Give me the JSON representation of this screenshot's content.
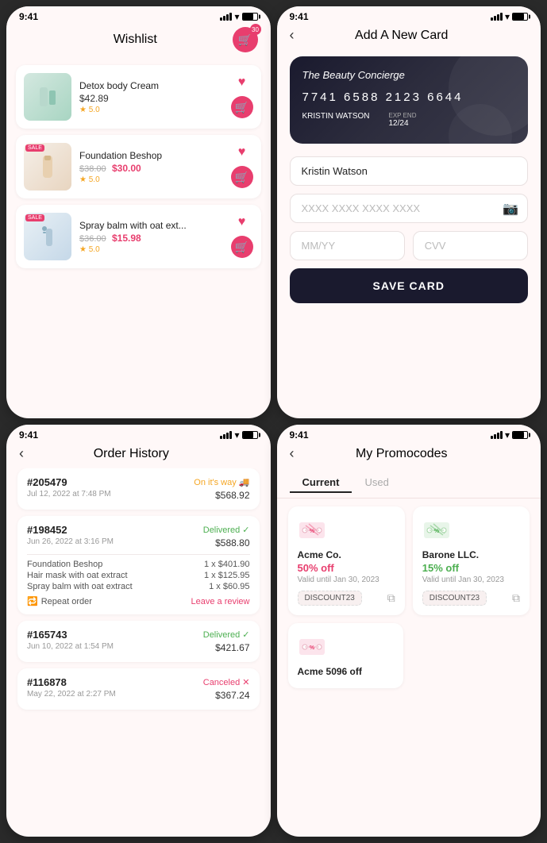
{
  "screen1": {
    "time": "9:41",
    "title": "Wishlist",
    "cart_count": "30",
    "items": [
      {
        "name": "Detox body Cream",
        "price": "$42.89",
        "old_price": null,
        "new_price": null,
        "rating": "5.0",
        "sale": false,
        "type": "cream"
      },
      {
        "name": "Foundation Beshop",
        "price": null,
        "old_price": "$38.00",
        "new_price": "$30.00",
        "rating": "5.0",
        "sale": true,
        "type": "foundation"
      },
      {
        "name": "Spray balm with oat ext...",
        "price": null,
        "old_price": "$36.00",
        "new_price": "$15.98",
        "rating": "5.0",
        "sale": true,
        "type": "spray"
      }
    ]
  },
  "screen2": {
    "time": "9:41",
    "title": "Add A New Card",
    "card": {
      "brand": "The Beauty Concierge",
      "number": "7741  6588  2123  6644",
      "name": "KRISTIN WATSON",
      "exp_label": "EXP END",
      "exp": "12/24"
    },
    "form": {
      "name_value": "Kristin Watson",
      "number_placeholder": "XXXX XXXX XXXX XXXX",
      "expiry_placeholder": "MM/YY",
      "cvv_placeholder": "CVV",
      "save_btn": "SAVE CARD"
    }
  },
  "screen3": {
    "time": "9:41",
    "title": "Order History",
    "orders": [
      {
        "id": "#205479",
        "status": "On it's way 🚚",
        "status_type": "on-way",
        "date": "Jul 12, 2022 at 7:48 PM",
        "amount": "$568.92",
        "items": []
      },
      {
        "id": "#198452",
        "status": "Delivered ✓",
        "status_type": "delivered",
        "date": "Jun 26, 2022 at 3:16 PM",
        "amount": "$588.80",
        "items": [
          {
            "name": "Foundation Beshop",
            "qty": "1 x",
            "price": "$401.90"
          },
          {
            "name": "Hair mask with oat extract",
            "qty": "1 x",
            "price": "$125.95"
          },
          {
            "name": "Spray balm with oat extract",
            "qty": "1 x",
            "price": "$60.95"
          }
        ],
        "repeat": "Repeat order",
        "review": "Leave a review"
      },
      {
        "id": "#165743",
        "status": "Delivered ✓",
        "status_type": "delivered",
        "date": "Jun 10, 2022 at 1:54 PM",
        "amount": "$421.67",
        "items": []
      },
      {
        "id": "#116878",
        "status": "Canceled ✕",
        "status_type": "canceled",
        "date": "May 22, 2022 at 2:27 PM",
        "amount": "$367.24",
        "items": []
      }
    ]
  },
  "screen4": {
    "time": "9:41",
    "title": "My Promocodes",
    "tabs": [
      "Current",
      "Used"
    ],
    "active_tab": "Current",
    "promos": [
      {
        "company": "Acme Co.",
        "discount": "50% off",
        "discount_type": "pink",
        "valid": "Valid until Jan 30, 2023",
        "code": "DISCOUNT23"
      },
      {
        "company": "Barone LLC.",
        "discount": "15% off",
        "discount_type": "green",
        "valid": "Valid until Jan 30, 2023",
        "code": "DISCOUNT23"
      }
    ],
    "partial_promo": {
      "company": "Acme 5096 off",
      "discount_type": "pink"
    }
  }
}
